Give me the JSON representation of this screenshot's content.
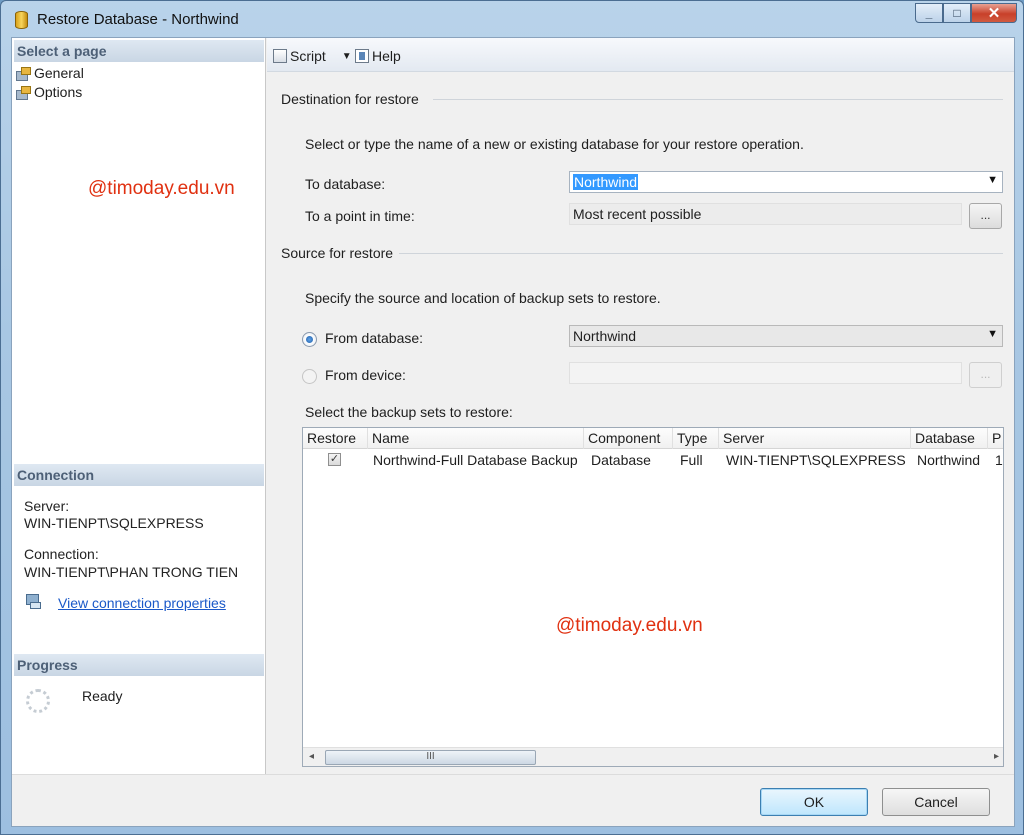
{
  "window": {
    "title": "Restore Database - Northwind",
    "controls": {
      "minimize": "_",
      "maximize": "□",
      "close": "✕"
    }
  },
  "left": {
    "select_page_header": "Select a page",
    "pages": [
      {
        "label": "General",
        "icon": "page-properties-icon"
      },
      {
        "label": "Options",
        "icon": "page-properties-icon"
      }
    ],
    "watermark": "@timoday.edu.vn",
    "connection_header": "Connection",
    "server_label": "Server:",
    "server_value": "WIN-TIENPT\\SQLEXPRESS",
    "connection_label": "Connection:",
    "connection_value": "WIN-TIENPT\\PHAN TRONG TIEN",
    "view_connection_link": "View connection properties",
    "progress_header": "Progress",
    "progress_status": "Ready"
  },
  "toolbar": {
    "script_label": "Script",
    "help_label": "Help"
  },
  "destination": {
    "group_label": "Destination for restore",
    "description": "Select or type the name of a new or existing database for your restore operation.",
    "to_database_label": "To database:",
    "to_database_value": "Northwind",
    "point_in_time_label": "To a point in time:",
    "point_in_time_value": "Most recent possible",
    "browse_button": "..."
  },
  "source": {
    "group_label": "Source for restore",
    "description": "Specify the source and location of backup sets to restore.",
    "from_database_label": "From database:",
    "from_database_value": "Northwind",
    "from_device_label": "From device:",
    "from_device_value": "",
    "device_browse_button": "...",
    "backup_sets_label": "Select the backup sets to restore:"
  },
  "grid": {
    "columns": [
      "Restore",
      "Name",
      "Component",
      "Type",
      "Server",
      "Database",
      "P"
    ],
    "rows": [
      {
        "restore": "✓",
        "name": "Northwind-Full Database Backup",
        "component": "Database",
        "type": "Full",
        "server": "WIN-TIENPT\\SQLEXPRESS",
        "database": "Northwind",
        "position": "1"
      }
    ],
    "watermark": "@timoday.edu.vn",
    "scroll_left": "◂",
    "scroll_right": "▸",
    "scroll_thumb": "III"
  },
  "buttons": {
    "ok": "OK",
    "cancel": "Cancel"
  },
  "colors": {
    "accent": "#3399ff",
    "watermark": "#e03010",
    "link": "#1a58c8"
  }
}
